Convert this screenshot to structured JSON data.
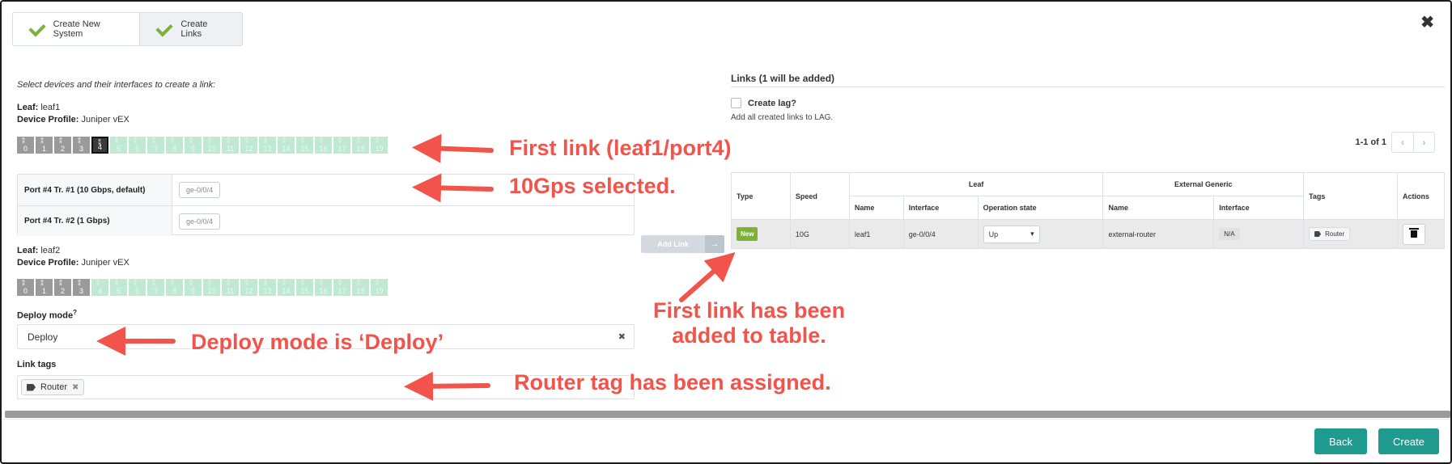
{
  "steps": [
    {
      "label": "Create New System"
    },
    {
      "label": "Create Links"
    }
  ],
  "left": {
    "intro": "Select devices and their interfaces to create a link:",
    "device1": {
      "leaf_key": "Leaf:",
      "leaf_val": "leaf1",
      "profile_key": "Device Profile:",
      "profile_val": "Juniper vEX"
    },
    "device2": {
      "leaf_key": "Leaf:",
      "leaf_val": "leaf2",
      "profile_key": "Device Profile:",
      "profile_val": "Juniper vEX"
    },
    "ports1": [
      "0",
      "1",
      "2",
      "3",
      "4",
      "5",
      "6",
      "7",
      "8",
      "9",
      "10",
      "11",
      "12",
      "13",
      "14",
      "15",
      "16",
      "17",
      "18",
      "19"
    ],
    "ports1_used": 4,
    "ports1_selected": 4,
    "ports2": [
      "0",
      "1",
      "2",
      "3",
      "4",
      "5",
      "6",
      "7",
      "8",
      "9",
      "10",
      "11",
      "12",
      "13",
      "14",
      "15",
      "16",
      "17",
      "18",
      "19"
    ],
    "ports2_used": 4,
    "transforms": [
      {
        "label": "Port #4 Tr. #1 (10 Gbps, default)",
        "value": "ge-0/0/4"
      },
      {
        "label": "Port #4 Tr. #2 (1 Gbps)",
        "value": "ge-0/0/4"
      }
    ],
    "deploy_label": "Deploy mode",
    "deploy_help": "?",
    "deploy_value": "Deploy",
    "deploy_clear": "✖",
    "tags_label": "Link tags",
    "tag_chip": "Router",
    "tag_remove": "✖"
  },
  "add_link": {
    "label": "Add Link",
    "arrow": "→"
  },
  "right": {
    "title": "Links (1 will be added)",
    "lag_label": "Create lag?",
    "lag_sub": "Add all created links to LAG.",
    "pager_text": "1-1 of 1",
    "pager_prev": "‹",
    "pager_next": "›",
    "headers": {
      "type": "Type",
      "speed": "Speed",
      "leaf": "Leaf",
      "ext": "External Generic",
      "name": "Name",
      "interface": "Interface",
      "opstate": "Operation state",
      "ext_name": "Name",
      "ext_interface": "Interface",
      "tags": "Tags",
      "actions": "Actions"
    },
    "row": {
      "badge": "New",
      "speed": "10G",
      "leaf_name": "leaf1",
      "leaf_if": "ge-0/0/4",
      "opstate": "Up",
      "ext_name": "external-router",
      "ext_if": "N/A",
      "tag": "Router"
    }
  },
  "footer": {
    "back": "Back",
    "create": "Create"
  },
  "close": "✖",
  "annotations": {
    "a1": "First link (leaf1/port4)",
    "a2": "10Gps selected.",
    "a3_line1": "First link has been",
    "a3_line2": "added to table.",
    "a4": "Deploy mode is ‘Deploy’",
    "a5": "Router tag has been assigned."
  },
  "colors": {
    "accent": "#1f9a8f",
    "check": "#7fb13a",
    "annotation": "#f2534a",
    "free_port": "#bfe9d2",
    "used_port": "#9a9a9a"
  }
}
